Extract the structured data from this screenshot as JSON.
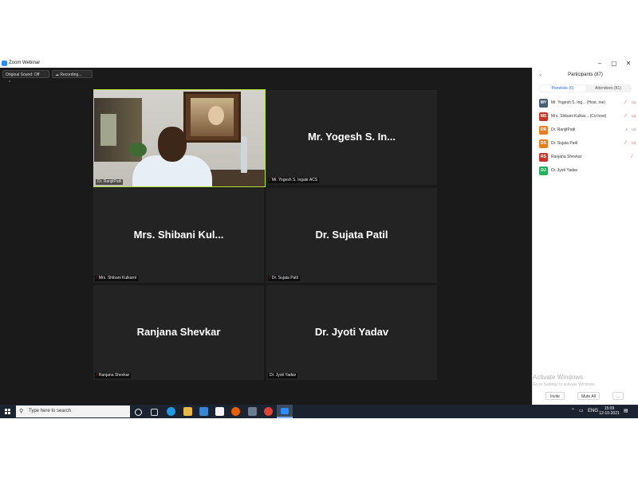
{
  "window": {
    "title": "Zoom Webinar",
    "controls": {
      "minimize": "–",
      "maximize": "▢",
      "close": "✕"
    }
  },
  "toolbar": {
    "sound_label": "Original Sound: Off",
    "recording_label": "Recording..."
  },
  "video_tile": {
    "label": "Dr. RanjitPatil"
  },
  "tiles": [
    {
      "display_name": "Mr. Yogesh S. In...",
      "label": "Mr. Yogesh S. Ingale ACS"
    },
    {
      "display_name": "Mrs. Shibani Kul...",
      "label": "Mrs. Shibani Kulkarni"
    },
    {
      "display_name": "Dr. Sujata Patil",
      "label": "Dr. Sujata Patil"
    },
    {
      "display_name": "Ranjana Shevkar",
      "label": "Ranjana Shevkar"
    },
    {
      "display_name": "Dr. Jyoti Yadav",
      "label": "Dr. Jyoti Yadav"
    }
  ],
  "participants": {
    "title": "Participants (87)",
    "tabs": {
      "panelists": "Panelists (6)",
      "attendees": "Attendees (81)"
    },
    "rows": [
      {
        "initials": "MY",
        "name": "Mr. Yogesh S. Ing...  (Host, me)",
        "color": "#4a5d78"
      },
      {
        "initials": "MS",
        "name": "Mrs. Shibani Kulkar...  (Co-host)",
        "color": "#c0392b"
      },
      {
        "initials": "DR",
        "name": "Dr. RanjitPatil",
        "color": "#e67e22"
      },
      {
        "initials": "DS",
        "name": "Dr. Sujata Patil",
        "color": "#e67e22"
      },
      {
        "initials": "RS",
        "name": "Ranjana Shevkar",
        "color": "#c0392b"
      },
      {
        "initials": "DJ",
        "name": "Dr. Jyoti Yadav",
        "color": "#27ae60"
      }
    ],
    "invite_label": "Invite",
    "mute_all_label": "Mute All",
    "more_label": "..."
  },
  "watermark": {
    "line1": "Activate Windows",
    "line2": "Go to Settings to activate Windows."
  },
  "taskbar": {
    "search_placeholder": "Type here to search",
    "language": "ENG",
    "time": "15:09",
    "date": "12-10-2021"
  },
  "colors": {
    "active_speaker_border": "#b7e23a",
    "accent": "#2d8cff",
    "muted": "#e23a3a"
  }
}
